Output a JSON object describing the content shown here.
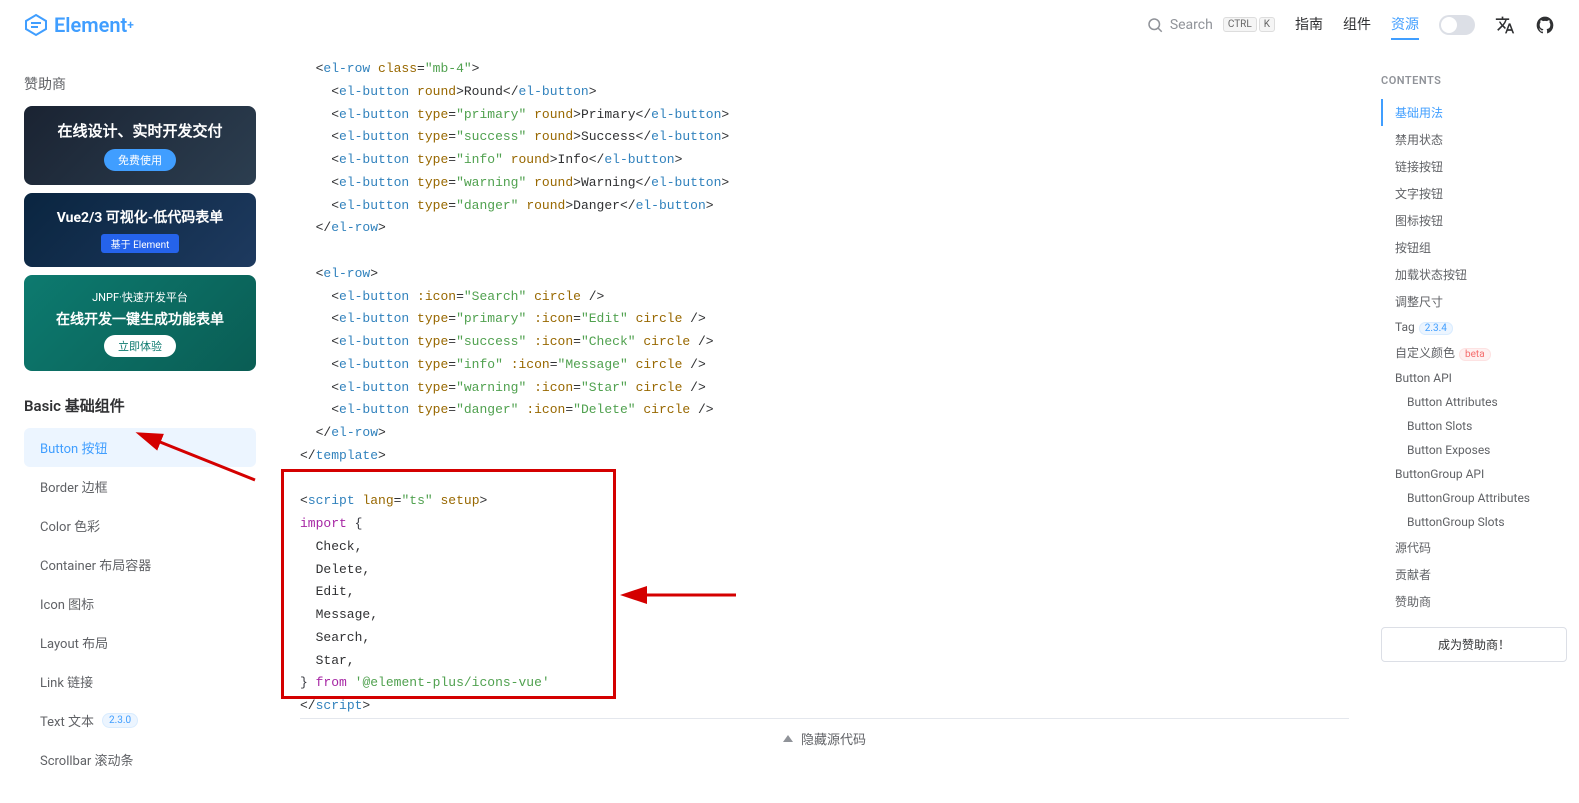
{
  "header": {
    "logo_text": "Element",
    "search_label": "Search",
    "kbd1": "CTRL",
    "kbd2": "K",
    "nav": [
      "指南",
      "组件",
      "资源"
    ],
    "nav_active": 2
  },
  "sidebar": {
    "sponsor_title": "赞助商",
    "sponsors": [
      {
        "title": "在线设计、实时开发交付",
        "button": "免费使用"
      },
      {
        "title": "Vue2/3 可视化-低代码表单",
        "button": "基于 Element"
      },
      {
        "pre": "JNPF·快速开发平台",
        "title": "在线开发一键生成功能表单",
        "button": "立即体验"
      }
    ],
    "section_title": "Basic 基础组件",
    "items": [
      {
        "label": "Button 按钮",
        "active": true
      },
      {
        "label": "Border 边框"
      },
      {
        "label": "Color 色彩"
      },
      {
        "label": "Container 布局容器"
      },
      {
        "label": "Icon 图标"
      },
      {
        "label": "Layout 布局"
      },
      {
        "label": "Link 链接"
      },
      {
        "label": "Text 文本",
        "badge": "2.3.0"
      },
      {
        "label": "Scrollbar 滚动条"
      }
    ]
  },
  "code": {
    "lines": [
      {
        "indent": 1,
        "type": "row_open",
        "attrs": " class=\"mb-4\""
      },
      {
        "indent": 2,
        "type": "btn",
        "attrs": " round",
        "text": "Round"
      },
      {
        "indent": 2,
        "type": "btn",
        "attrs": " type=\"primary\" round",
        "text": "Primary"
      },
      {
        "indent": 2,
        "type": "btn",
        "attrs": " type=\"success\" round",
        "text": "Success"
      },
      {
        "indent": 2,
        "type": "btn",
        "attrs": " type=\"info\" round",
        "text": "Info"
      },
      {
        "indent": 2,
        "type": "btn",
        "attrs": " type=\"warning\" round",
        "text": "Warning"
      },
      {
        "indent": 2,
        "type": "btn",
        "attrs": " type=\"danger\" round",
        "text": "Danger"
      },
      {
        "indent": 1,
        "type": "row_close"
      },
      {
        "indent": 0,
        "type": "blank"
      },
      {
        "indent": 1,
        "type": "row_open",
        "attrs": ""
      },
      {
        "indent": 2,
        "type": "btn_self",
        "attrs": " :icon=\"Search\" circle"
      },
      {
        "indent": 2,
        "type": "btn_self",
        "attrs": " type=\"primary\" :icon=\"Edit\" circle"
      },
      {
        "indent": 2,
        "type": "btn_self",
        "attrs": " type=\"success\" :icon=\"Check\" circle"
      },
      {
        "indent": 2,
        "type": "btn_self",
        "attrs": " type=\"info\" :icon=\"Message\" circle"
      },
      {
        "indent": 2,
        "type": "btn_self",
        "attrs": " type=\"warning\" :icon=\"Star\" circle"
      },
      {
        "indent": 2,
        "type": "btn_self",
        "attrs": " type=\"danger\" :icon=\"Delete\" circle"
      },
      {
        "indent": 1,
        "type": "row_close"
      },
      {
        "indent": 0,
        "type": "template_close"
      }
    ],
    "script_block": {
      "open_attrs": " lang=\"ts\" setup",
      "import_kw": "import",
      "imports": [
        "Check",
        "Delete",
        "Edit",
        "Message",
        "Search",
        "Star"
      ],
      "from_kw": "from",
      "from_path": "'@element-plus/icons-vue'"
    }
  },
  "footer_bar": "隐藏源代码",
  "toc": {
    "title": "CONTENTS",
    "items": [
      {
        "label": "基础用法",
        "active": true
      },
      {
        "label": "禁用状态"
      },
      {
        "label": "链接按钮"
      },
      {
        "label": "文字按钮"
      },
      {
        "label": "图标按钮"
      },
      {
        "label": "按钮组"
      },
      {
        "label": "加载状态按钮"
      },
      {
        "label": "调整尺寸"
      },
      {
        "label": "Tag",
        "badge": "2.3.4"
      },
      {
        "label": "自定义颜色",
        "badge": "beta",
        "beta": true
      },
      {
        "label": "Button API"
      },
      {
        "label": "Button Attributes",
        "sub": true
      },
      {
        "label": "Button Slots",
        "sub": true
      },
      {
        "label": "Button Exposes",
        "sub": true
      },
      {
        "label": "ButtonGroup API"
      },
      {
        "label": "ButtonGroup Attributes",
        "sub": true
      },
      {
        "label": "ButtonGroup Slots",
        "sub": true
      },
      {
        "label": "源代码"
      },
      {
        "label": "贡献者"
      },
      {
        "label": "赞助商"
      }
    ],
    "become_sponsor": "成为赞助商！"
  }
}
